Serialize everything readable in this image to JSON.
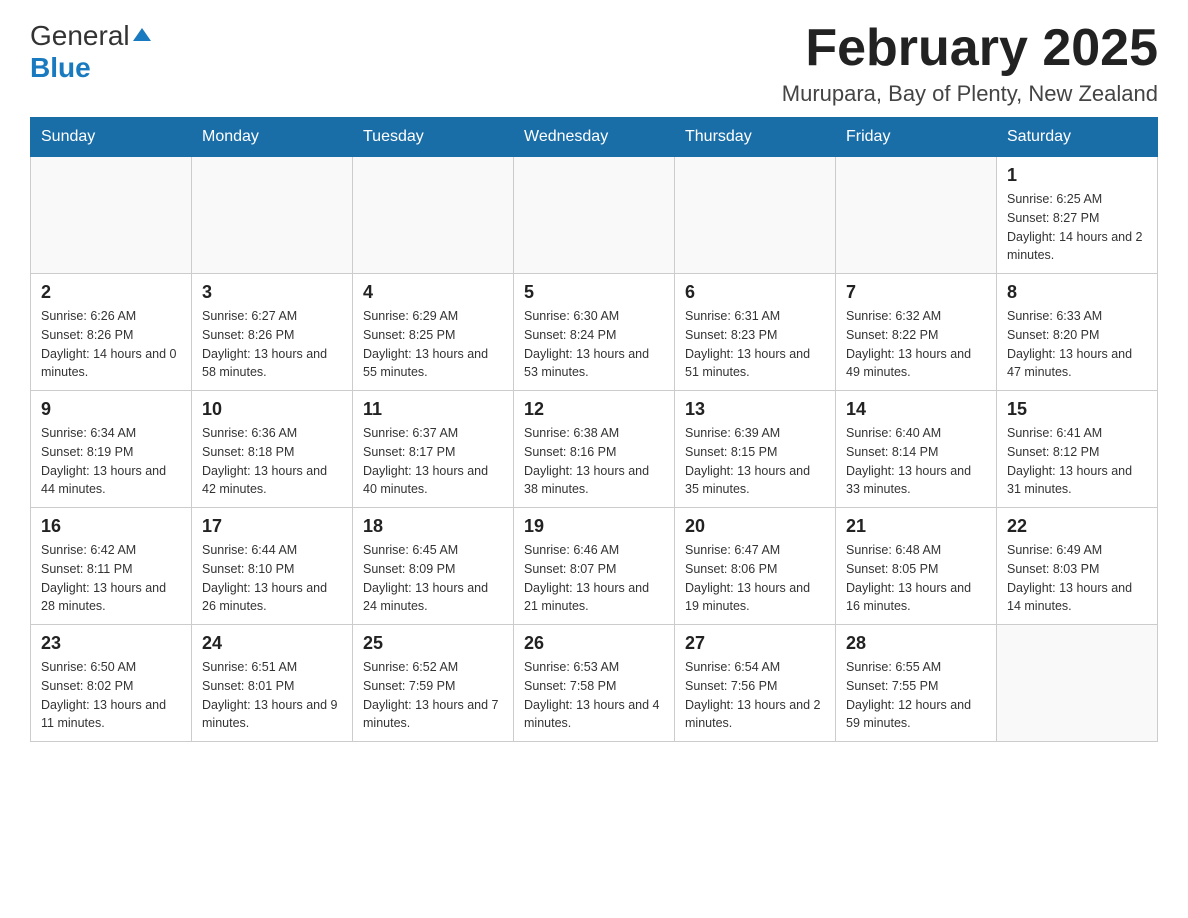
{
  "header": {
    "logo_general": "General",
    "logo_blue": "Blue",
    "month_title": "February 2025",
    "location": "Murupara, Bay of Plenty, New Zealand"
  },
  "weekdays": [
    "Sunday",
    "Monday",
    "Tuesday",
    "Wednesday",
    "Thursday",
    "Friday",
    "Saturday"
  ],
  "weeks": [
    [
      {
        "day": "",
        "info": ""
      },
      {
        "day": "",
        "info": ""
      },
      {
        "day": "",
        "info": ""
      },
      {
        "day": "",
        "info": ""
      },
      {
        "day": "",
        "info": ""
      },
      {
        "day": "",
        "info": ""
      },
      {
        "day": "1",
        "info": "Sunrise: 6:25 AM\nSunset: 8:27 PM\nDaylight: 14 hours and 2 minutes."
      }
    ],
    [
      {
        "day": "2",
        "info": "Sunrise: 6:26 AM\nSunset: 8:26 PM\nDaylight: 14 hours and 0 minutes."
      },
      {
        "day": "3",
        "info": "Sunrise: 6:27 AM\nSunset: 8:26 PM\nDaylight: 13 hours and 58 minutes."
      },
      {
        "day": "4",
        "info": "Sunrise: 6:29 AM\nSunset: 8:25 PM\nDaylight: 13 hours and 55 minutes."
      },
      {
        "day": "5",
        "info": "Sunrise: 6:30 AM\nSunset: 8:24 PM\nDaylight: 13 hours and 53 minutes."
      },
      {
        "day": "6",
        "info": "Sunrise: 6:31 AM\nSunset: 8:23 PM\nDaylight: 13 hours and 51 minutes."
      },
      {
        "day": "7",
        "info": "Sunrise: 6:32 AM\nSunset: 8:22 PM\nDaylight: 13 hours and 49 minutes."
      },
      {
        "day": "8",
        "info": "Sunrise: 6:33 AM\nSunset: 8:20 PM\nDaylight: 13 hours and 47 minutes."
      }
    ],
    [
      {
        "day": "9",
        "info": "Sunrise: 6:34 AM\nSunset: 8:19 PM\nDaylight: 13 hours and 44 minutes."
      },
      {
        "day": "10",
        "info": "Sunrise: 6:36 AM\nSunset: 8:18 PM\nDaylight: 13 hours and 42 minutes."
      },
      {
        "day": "11",
        "info": "Sunrise: 6:37 AM\nSunset: 8:17 PM\nDaylight: 13 hours and 40 minutes."
      },
      {
        "day": "12",
        "info": "Sunrise: 6:38 AM\nSunset: 8:16 PM\nDaylight: 13 hours and 38 minutes."
      },
      {
        "day": "13",
        "info": "Sunrise: 6:39 AM\nSunset: 8:15 PM\nDaylight: 13 hours and 35 minutes."
      },
      {
        "day": "14",
        "info": "Sunrise: 6:40 AM\nSunset: 8:14 PM\nDaylight: 13 hours and 33 minutes."
      },
      {
        "day": "15",
        "info": "Sunrise: 6:41 AM\nSunset: 8:12 PM\nDaylight: 13 hours and 31 minutes."
      }
    ],
    [
      {
        "day": "16",
        "info": "Sunrise: 6:42 AM\nSunset: 8:11 PM\nDaylight: 13 hours and 28 minutes."
      },
      {
        "day": "17",
        "info": "Sunrise: 6:44 AM\nSunset: 8:10 PM\nDaylight: 13 hours and 26 minutes."
      },
      {
        "day": "18",
        "info": "Sunrise: 6:45 AM\nSunset: 8:09 PM\nDaylight: 13 hours and 24 minutes."
      },
      {
        "day": "19",
        "info": "Sunrise: 6:46 AM\nSunset: 8:07 PM\nDaylight: 13 hours and 21 minutes."
      },
      {
        "day": "20",
        "info": "Sunrise: 6:47 AM\nSunset: 8:06 PM\nDaylight: 13 hours and 19 minutes."
      },
      {
        "day": "21",
        "info": "Sunrise: 6:48 AM\nSunset: 8:05 PM\nDaylight: 13 hours and 16 minutes."
      },
      {
        "day": "22",
        "info": "Sunrise: 6:49 AM\nSunset: 8:03 PM\nDaylight: 13 hours and 14 minutes."
      }
    ],
    [
      {
        "day": "23",
        "info": "Sunrise: 6:50 AM\nSunset: 8:02 PM\nDaylight: 13 hours and 11 minutes."
      },
      {
        "day": "24",
        "info": "Sunrise: 6:51 AM\nSunset: 8:01 PM\nDaylight: 13 hours and 9 minutes."
      },
      {
        "day": "25",
        "info": "Sunrise: 6:52 AM\nSunset: 7:59 PM\nDaylight: 13 hours and 7 minutes."
      },
      {
        "day": "26",
        "info": "Sunrise: 6:53 AM\nSunset: 7:58 PM\nDaylight: 13 hours and 4 minutes."
      },
      {
        "day": "27",
        "info": "Sunrise: 6:54 AM\nSunset: 7:56 PM\nDaylight: 13 hours and 2 minutes."
      },
      {
        "day": "28",
        "info": "Sunrise: 6:55 AM\nSunset: 7:55 PM\nDaylight: 12 hours and 59 minutes."
      },
      {
        "day": "",
        "info": ""
      }
    ]
  ]
}
